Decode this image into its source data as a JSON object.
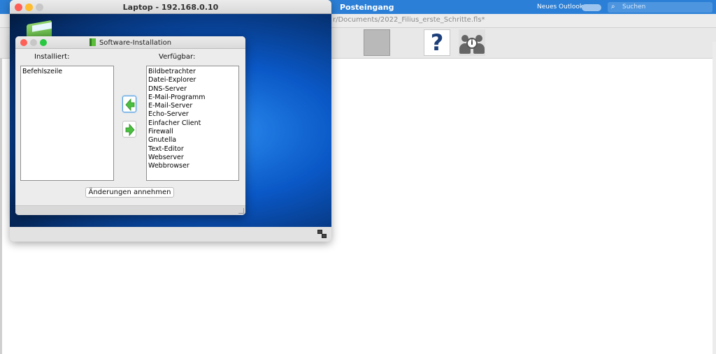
{
  "outlook": {
    "title": "Posteingang",
    "new_outlook_label": "Neues Outlook",
    "search_placeholder": "Suchen"
  },
  "filius": {
    "path": "r/Documents/2022_Filius_erste_Schritte.fls*",
    "help_glyph": "?"
  },
  "laptop": {
    "title": "Laptop - 192.168.0.10"
  },
  "dialog": {
    "title": "Software-Installation",
    "installed_label": "Installiert:",
    "available_label": "Verfügbar:",
    "installed": [
      "Befehlszeile"
    ],
    "available": [
      "Bildbetrachter",
      "Datei-Explorer",
      "DNS-Server",
      "E-Mail-Programm",
      "E-Mail-Server",
      "Echo-Server",
      "Einfacher Client",
      "Firewall",
      "Gnutella",
      "Text-Editor",
      "Webserver",
      "Webbrowser"
    ],
    "apply_label": "Änderungen annehmen"
  },
  "colors": {
    "outlook_blue": "#2b7fd6",
    "arrow_green": "#4bbf3f",
    "traffic_red": "#fe5f57",
    "traffic_yellow": "#febc2e",
    "traffic_green": "#28c840"
  }
}
